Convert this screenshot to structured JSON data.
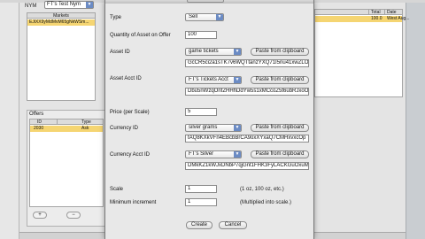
{
  "background": {
    "nym_label": "NYM",
    "nym_select": "FT's Test Nym",
    "markets": {
      "header": "Markets",
      "rows": [
        "EJiXX9yMdMvM65gNkWSm..."
      ]
    },
    "markets_right": {
      "headers": [
        "Total",
        "Date"
      ],
      "row": [
        "100.0",
        "West Aug..."
      ]
    },
    "offers": {
      "label": "Offers",
      "headers": [
        "ID",
        "Type"
      ],
      "row": [
        "2030",
        "Ask"
      ],
      "add_label": "+",
      "remove_label": "−"
    }
  },
  "dialog": {
    "type": {
      "label": "Type",
      "value": "Sell"
    },
    "quantity": {
      "label": "Quantity of Asset on Offer",
      "value": "100"
    },
    "asset_id": {
      "label": "Asset ID",
      "select": "game tickets",
      "paste": "Paste from clipboard",
      "value": "GcCR5ci2a1sTK7v6WQTtanzYXQ71I5nu41xwZLOz"
    },
    "asset_acct_id": {
      "label": "Asset Acct ID",
      "select": "FT's Tickets Acct",
      "paste": "Paste from clipboard",
      "value": "Dbu5nWzqOnfZHHhDdYw5s1xMCcoZ5t6ubRJxoOD"
    },
    "price": {
      "label": "Price (per Scale)",
      "value": "5"
    },
    "currency_id": {
      "label": "Currency ID",
      "select": "silver grams",
      "paste": "Paste from clipboard",
      "value": "tAQ8KXkVFn4EBcbBrCA9oxXYxaQ7CMHxvxcOp"
    },
    "currency_acct_id": {
      "label": "Currency Acct ID",
      "select": "FT's Silver",
      "paste": "Paste from clipboard",
      "value": "DMkKZ1kWJxDNbP7qjGnt1FHK3FyLACKGuOxuMC"
    },
    "scale": {
      "label": "Scale",
      "value": "1",
      "hint": "(1 oz, 100 oz, etc.)"
    },
    "min_increment": {
      "label": "Minimum increment",
      "value": "1",
      "hint": "(Multiplied into scale.)"
    },
    "create_label": "Create",
    "cancel_label": "Cancel"
  }
}
